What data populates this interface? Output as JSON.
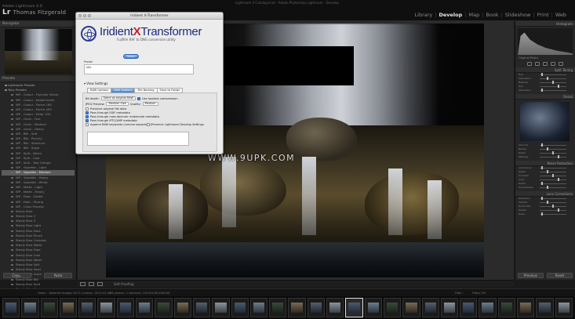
{
  "app": {
    "brand_name": "Lr",
    "identity_line1": "Adobe Lightroom 4.0",
    "identity_line2": "Thomas Fitzgerald",
    "window_title": "Lightroom 4 Catalog.lrcat - Adobe Photoshop Lightroom - Develop",
    "modules": [
      {
        "label": "Library",
        "active": false
      },
      {
        "label": "Develop",
        "active": true
      },
      {
        "label": "Map",
        "active": false
      },
      {
        "label": "Book",
        "active": false
      },
      {
        "label": "Slideshow",
        "active": false
      },
      {
        "label": "Print",
        "active": false
      },
      {
        "label": "Web",
        "active": false
      }
    ]
  },
  "left_panel": {
    "navigator_label": "Navigator",
    "presets_label": "Presets",
    "preset_groups": [
      {
        "label": "Lightroom Presets",
        "group": true
      },
      {
        "label": "Tony Presets",
        "group": true
      }
    ],
    "presets": [
      "WP - Colour - Fujicolor Velvia",
      "WP - Colour - Kodachrome",
      "WP - Colour - Portra 160",
      "WP - Colour - Portra 400",
      "WP - Colour - Ektar 100",
      "WP - Grain - Fine",
      "WP - Grain - Medium",
      "WP - Grain - Heavy",
      "WP - BW - Soft",
      "WP - BW - Punchy",
      "WP - BW - Selenium",
      "WP - BW - Sepia",
      "WP - Split - Warm",
      "WP - Split - Cool",
      "WP - Split - Teal Orange",
      "WP - Vignette - Light",
      "WP - Vignette - Medium",
      "WP - Vignette - Heavy",
      "WP - Vignette - White",
      "WP - Matte - Light",
      "WP - Matte - Heavy",
      "WP - Fade - Subtle",
      "WP - Fade - Strong",
      "WP - Cross Process",
      "Steely Blue",
      "Steely Blue 2",
      "Steely Blue 3",
      "Steely Blue Light",
      "Steely Blue Dark",
      "Steely Blue Punch",
      "Steely Blue Contrast",
      "Steely Blue Matte",
      "Steely Blue Fade",
      "Steely Blue Cool",
      "Steely Blue Warm",
      "Steely Blue Soft",
      "Steely Blue Hard",
      "Steely Blue Grain",
      "Steely Blue BW",
      "Steely Blue Split",
      "Steely Blue Vintage",
      "Steely Blue Film"
    ],
    "selected_index": 16,
    "copy_label": "Copy...",
    "paste_label": "Paste"
  },
  "dialog": {
    "title": "Iridient X-Transformer",
    "logo_name_part1": "Iridient",
    "logo_name_x": "X",
    "logo_name_part2": "Transformer",
    "logo_tagline": "Fujifilm RAF to DNG conversion utility",
    "select_button": "Select",
    "preset_label": "Preset",
    "preset_value": "Idle",
    "settings_label": "View Settings",
    "tabs": [
      {
        "label": "RAW Options",
        "active": false
      },
      {
        "label": "DNG Options",
        "active": true
      },
      {
        "label": "File Naming",
        "active": false
      },
      {
        "label": "Save to Folder",
        "active": false
      }
    ],
    "bit_depth_label": "Bit depth:",
    "bit_depth_value": "Same as original RAW",
    "lossless_label": "Use lossless compression",
    "jpeg_label": "JPEG Preview:",
    "jpeg_value": "Medium Size",
    "quality_label": "Quality:",
    "quality_value": "Medium",
    "checkboxes": [
      {
        "label": "Preserve original file data",
        "on": false
      },
      {
        "label": "Pass through EXIF metadata",
        "on": true
      },
      {
        "label": "Pass through manufacturer makernote metadata",
        "on": true
      },
      {
        "label": "Pass through IPTC/XMP metadata",
        "on": true
      },
      {
        "label": "Append RAW keywords (comma separated)",
        "on": false
      }
    ],
    "lightroom_label": "Preserve Lightroom Develop Settings"
  },
  "watermark": "WWW.9UPK.COM",
  "right_panel": {
    "histogram_label": "Histogram",
    "original_photo_label": "Original Photo",
    "split_toning_label": "Split Toning",
    "detail_label": "Detail",
    "noise_label": "Noise Reduction",
    "lens_label": "Lens Corrections",
    "split_sliders": [
      "Hue",
      "Saturation",
      "Balance",
      "Hue",
      "Saturation"
    ],
    "detail_sliders": [
      "Amount",
      "Radius",
      "Detail",
      "Masking"
    ],
    "noise_sliders": [
      "Luminance",
      "Detail",
      "Contrast",
      "Color",
      "Detail",
      "Smoothness"
    ],
    "lens_sliders": [
      "Distortion",
      "Vertical",
      "Horizontal",
      "Rotate",
      "Scale"
    ],
    "previous_label": "Previous",
    "reset_label": "Reset"
  },
  "toolbar": {
    "soft_proofing_label": "Soft Proofing"
  },
  "filmstrip": {
    "path": "Folder : Waterfall Images 2013 / Ireland / 2013-03-06",
    "count": "48 photos / 1 selected / 201301061458.RAF",
    "filter_label": "Filter :",
    "filter_value": "Filters Off",
    "thumb_count": 30,
    "selected_index": 18
  },
  "colors": {
    "accent_blue": "#3d80da",
    "logo_blue": "#1d2b7a",
    "logo_red": "#c0202a"
  }
}
